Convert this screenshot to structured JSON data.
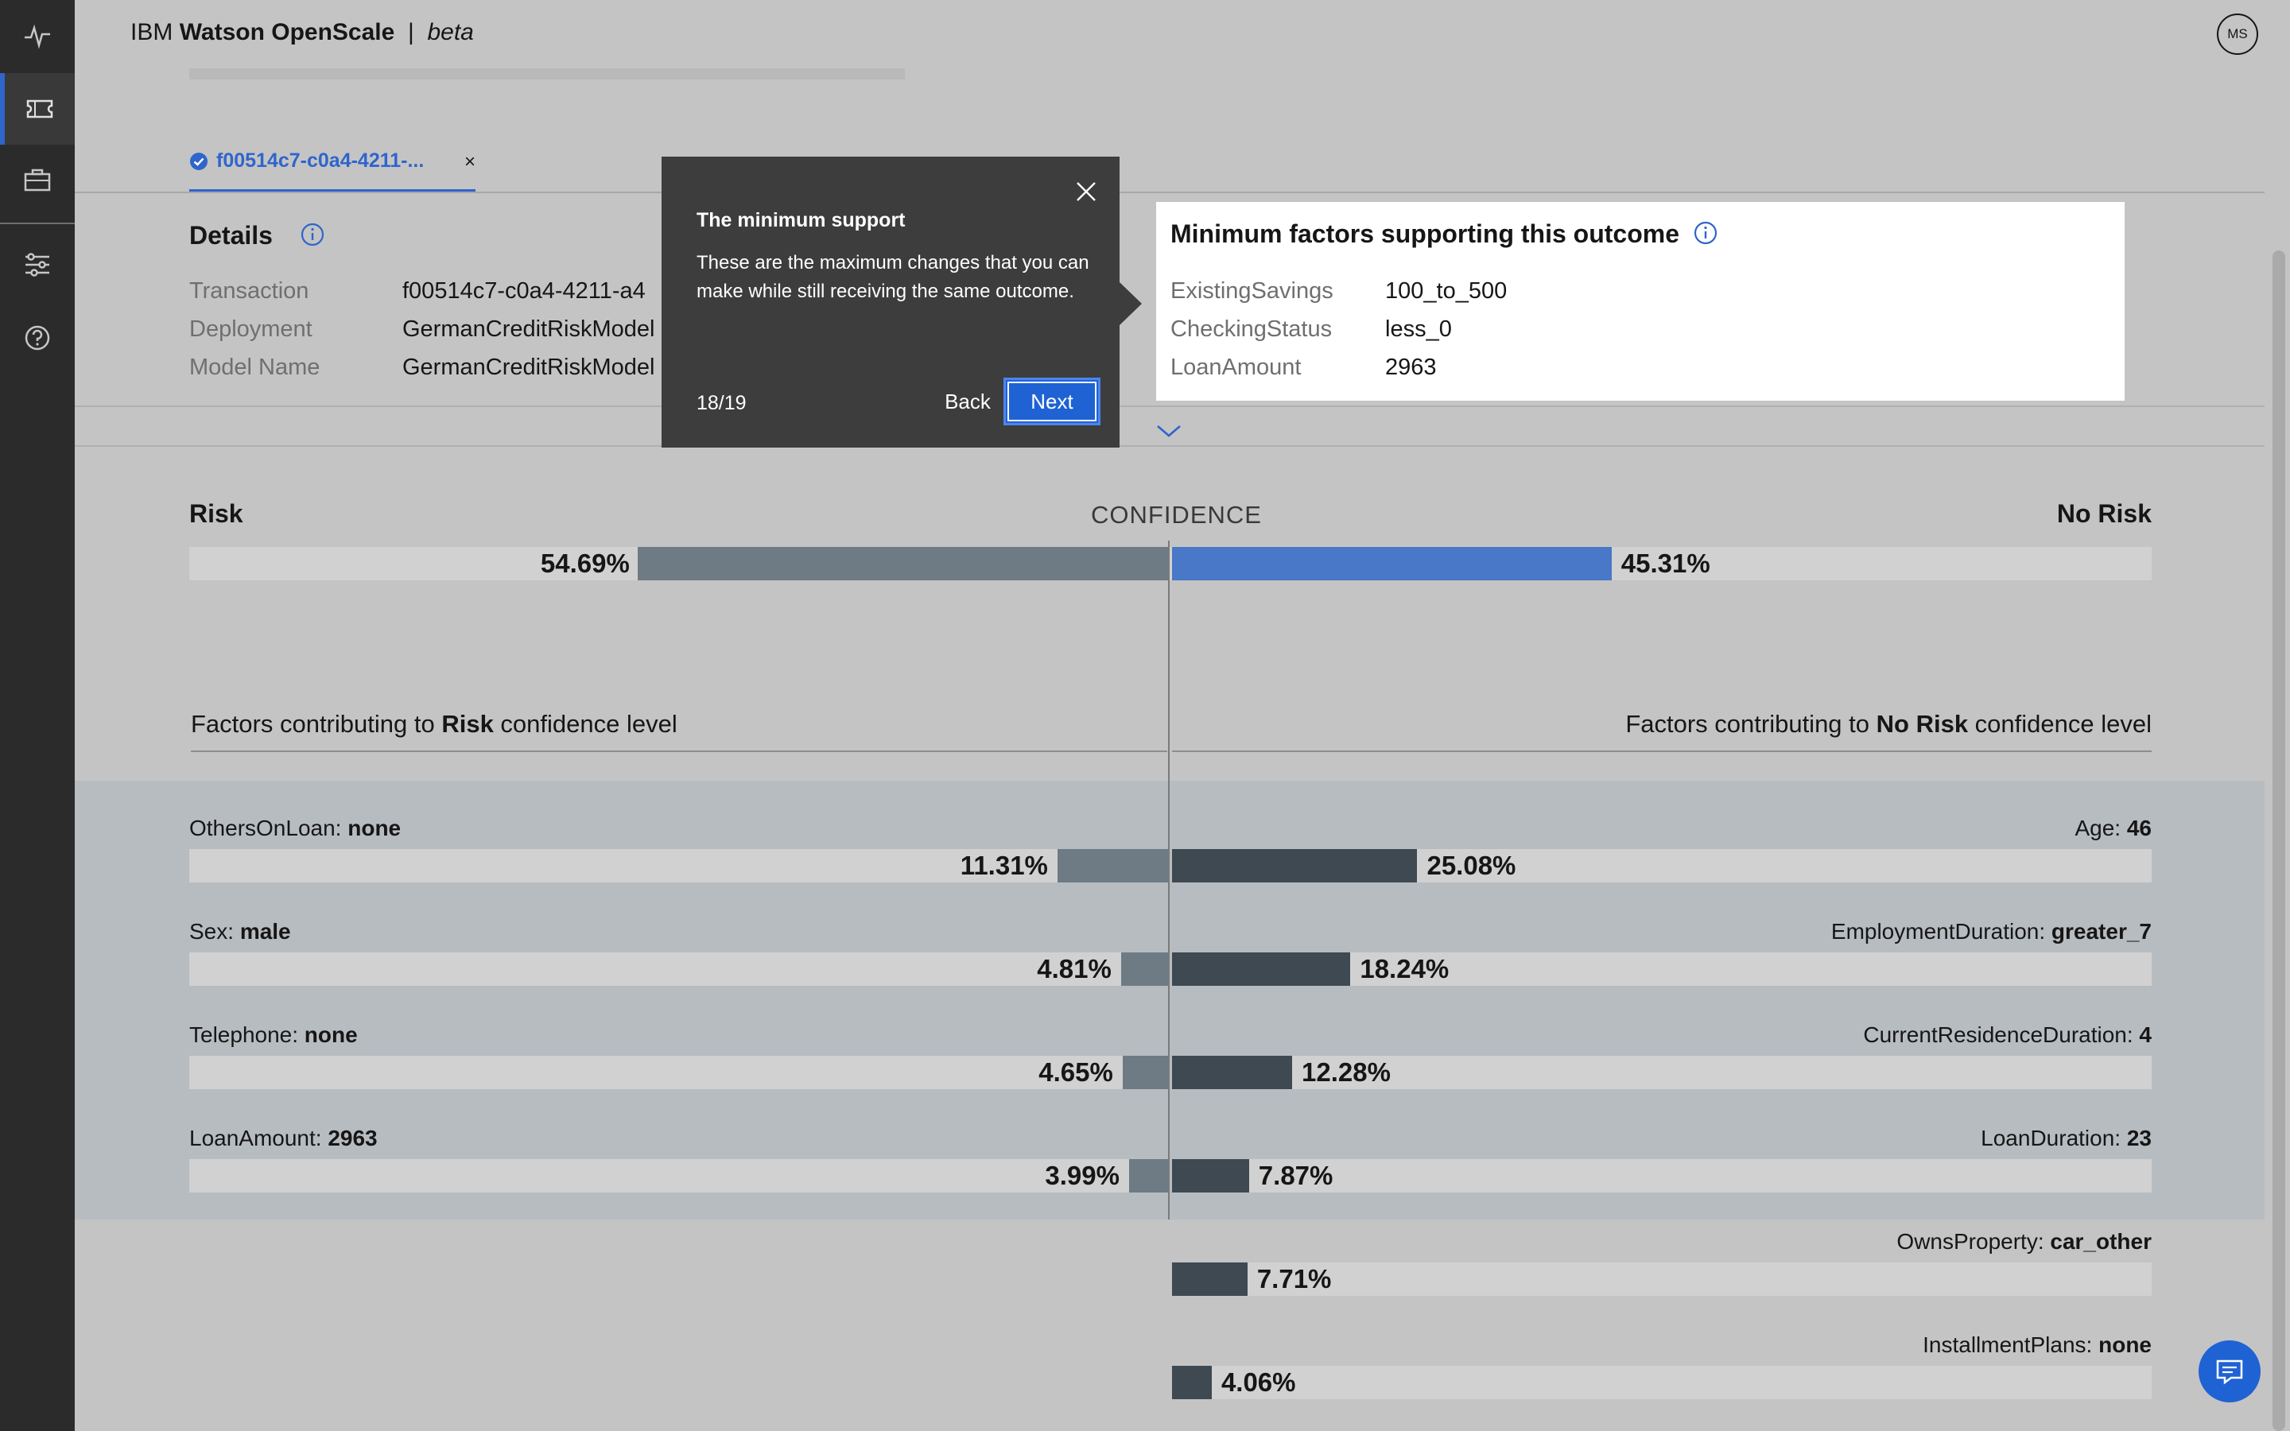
{
  "header": {
    "brand_prefix": "IBM",
    "brand_name": "Watson OpenScale",
    "separator": "|",
    "brand_suffix": "beta",
    "avatar_initials": "MS"
  },
  "sidebar": {
    "items": [
      {
        "icon": "activity-icon"
      },
      {
        "icon": "ticket-icon",
        "active": true
      },
      {
        "icon": "briefcase-icon"
      },
      {
        "icon": "sliders-icon"
      },
      {
        "icon": "help-icon"
      }
    ]
  },
  "tab": {
    "label": "f00514c7-c0a4-4211-...",
    "close": "×"
  },
  "details": {
    "title": "Details",
    "rows": [
      {
        "key": "Transaction",
        "value": "f00514c7-c0a4-4211-a4"
      },
      {
        "key": "Deployment",
        "value": "GermanCreditRiskModel"
      },
      {
        "key": "Model Name",
        "value": "GermanCreditRiskModel"
      }
    ]
  },
  "support": {
    "title": "Minimum factors supporting this outcome",
    "rows": [
      {
        "key": "ExistingSavings",
        "value": "100_to_500"
      },
      {
        "key": "CheckingStatus",
        "value": "less_0"
      },
      {
        "key": "LoanAmount",
        "value": "2963"
      }
    ]
  },
  "tooltip": {
    "title": "The minimum support",
    "body": "These are the maximum changes that you can make while still receiving the same outcome.",
    "step": "18/19",
    "back_label": "Back",
    "next_label": "Next"
  },
  "confidence": {
    "left_label": "Risk",
    "center_label": "CONFIDENCE",
    "right_label": "No Risk",
    "risk_pct": "54.69%",
    "norisk_pct": "45.31%",
    "risk_value": 54.69,
    "norisk_value": 45.31
  },
  "contributions": {
    "risk_heading_prefix": "Factors contributing to ",
    "risk_heading_bold": "Risk",
    "risk_heading_suffix": " confidence level",
    "norisk_heading_prefix": "Factors contributing to ",
    "norisk_heading_bold": "No Risk",
    "norisk_heading_suffix": " confidence level",
    "risk_factors": [
      {
        "name": "OthersOnLoan: ",
        "value": "none",
        "pct": "11.31%",
        "amount": 11.31
      },
      {
        "name": "Sex: ",
        "value": "male",
        "pct": "4.81%",
        "amount": 4.81
      },
      {
        "name": "Telephone: ",
        "value": "none",
        "pct": "4.65%",
        "amount": 4.65
      },
      {
        "name": "LoanAmount: ",
        "value": "2963",
        "pct": "3.99%",
        "amount": 3.99
      }
    ],
    "norisk_factors": [
      {
        "name": "Age: ",
        "value": "46",
        "pct": "25.08%",
        "amount": 25.08
      },
      {
        "name": "EmploymentDuration: ",
        "value": "greater_7",
        "pct": "18.24%",
        "amount": 18.24
      },
      {
        "name": "CurrentResidenceDuration: ",
        "value": "4",
        "pct": "12.28%",
        "amount": 12.28
      },
      {
        "name": "LoanDuration: ",
        "value": "23",
        "pct": "7.87%",
        "amount": 7.87
      },
      {
        "name": "OwnsProperty: ",
        "value": "car_other",
        "pct": "7.71%",
        "amount": 7.71
      },
      {
        "name": "InstallmentPlans: ",
        "value": "none",
        "pct": "4.06%",
        "amount": 4.06
      }
    ]
  },
  "colors": {
    "accent": "#2f65cc",
    "risk_bar": "#6e7b84",
    "norisk_bar": "#3f4952",
    "confidence_norisk": "#4878c7",
    "tooltip_bg": "#3d3d3d"
  }
}
